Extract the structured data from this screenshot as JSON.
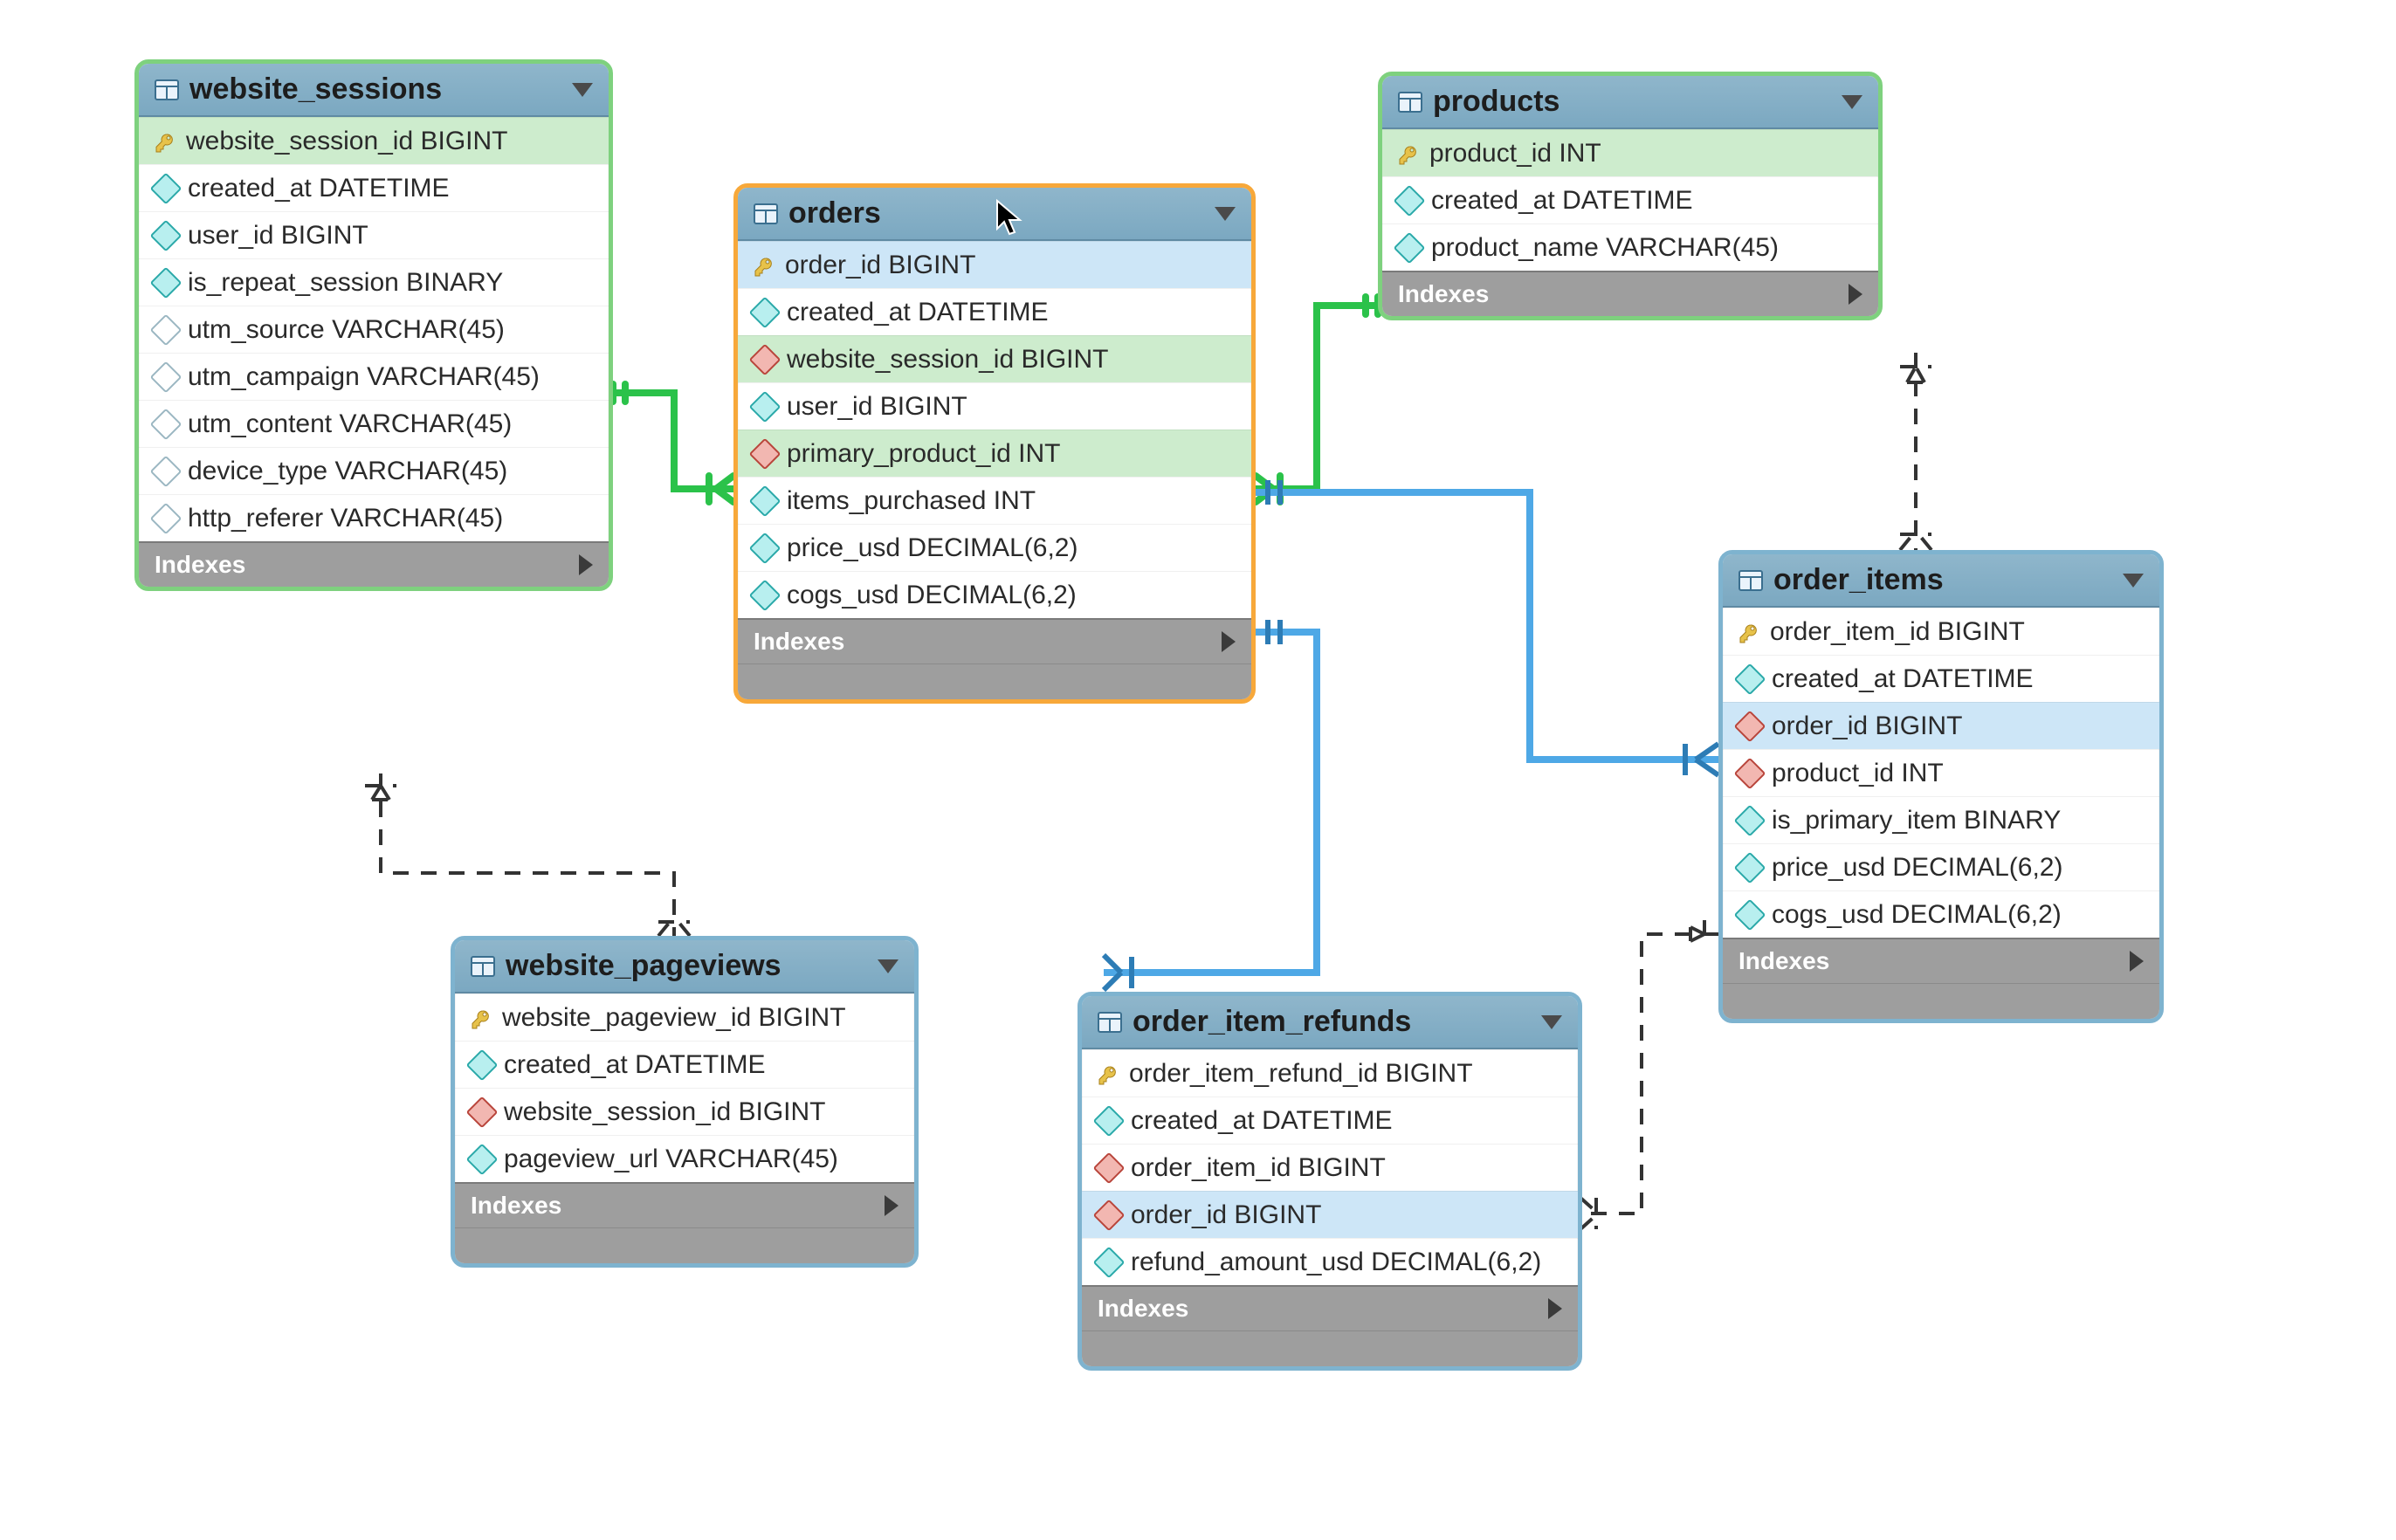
{
  "indexes_label": "Indexes",
  "tables": {
    "website_sessions": {
      "title": "website_sessions",
      "cols": [
        {
          "icon": "key",
          "text": "website_session_id BIGINT",
          "hl": "pk"
        },
        {
          "icon": "cyan",
          "text": "created_at DATETIME"
        },
        {
          "icon": "cyan",
          "text": "user_id BIGINT"
        },
        {
          "icon": "cyan",
          "text": "is_repeat_session BINARY"
        },
        {
          "icon": "hollow",
          "text": "utm_source VARCHAR(45)"
        },
        {
          "icon": "hollow",
          "text": "utm_campaign VARCHAR(45)"
        },
        {
          "icon": "hollow",
          "text": "utm_content VARCHAR(45)"
        },
        {
          "icon": "hollow",
          "text": "device_type VARCHAR(45)"
        },
        {
          "icon": "hollow",
          "text": "http_referer VARCHAR(45)"
        }
      ]
    },
    "orders": {
      "title": "orders",
      "cols": [
        {
          "icon": "key",
          "text": "order_id BIGINT",
          "hl": "pk2"
        },
        {
          "icon": "cyan",
          "text": "created_at DATETIME"
        },
        {
          "icon": "red",
          "text": "website_session_id BIGINT",
          "hl": "fk-green"
        },
        {
          "icon": "cyan",
          "text": "user_id BIGINT"
        },
        {
          "icon": "red",
          "text": "primary_product_id INT",
          "hl": "fk-green"
        },
        {
          "icon": "cyan",
          "text": "items_purchased INT"
        },
        {
          "icon": "cyan",
          "text": "price_usd DECIMAL(6,2)"
        },
        {
          "icon": "cyan",
          "text": "cogs_usd DECIMAL(6,2)"
        }
      ]
    },
    "products": {
      "title": "products",
      "cols": [
        {
          "icon": "key",
          "text": "product_id INT",
          "hl": "pk"
        },
        {
          "icon": "cyan",
          "text": "created_at DATETIME"
        },
        {
          "icon": "cyan",
          "text": "product_name VARCHAR(45)"
        }
      ]
    },
    "website_pageviews": {
      "title": "website_pageviews",
      "cols": [
        {
          "icon": "key",
          "text": "website_pageview_id BIGINT"
        },
        {
          "icon": "cyan",
          "text": "created_at DATETIME"
        },
        {
          "icon": "red",
          "text": "website_session_id BIGINT"
        },
        {
          "icon": "cyan",
          "text": "pageview_url VARCHAR(45)"
        }
      ]
    },
    "order_items": {
      "title": "order_items",
      "cols": [
        {
          "icon": "key",
          "text": "order_item_id BIGINT"
        },
        {
          "icon": "cyan",
          "text": "created_at DATETIME"
        },
        {
          "icon": "red",
          "text": "order_id BIGINT",
          "hl": "fk-blue"
        },
        {
          "icon": "red",
          "text": "product_id INT"
        },
        {
          "icon": "cyan",
          "text": "is_primary_item BINARY"
        },
        {
          "icon": "cyan",
          "text": "price_usd DECIMAL(6,2)"
        },
        {
          "icon": "cyan",
          "text": "cogs_usd DECIMAL(6,2)"
        }
      ]
    },
    "order_item_refunds": {
      "title": "order_item_refunds",
      "cols": [
        {
          "icon": "key",
          "text": "order_item_refund_id BIGINT"
        },
        {
          "icon": "cyan",
          "text": "created_at DATETIME"
        },
        {
          "icon": "red",
          "text": "order_item_id BIGINT"
        },
        {
          "icon": "red",
          "text": "order_id BIGINT",
          "hl": "fk-blue"
        },
        {
          "icon": "cyan",
          "text": "refund_amount_usd DECIMAL(6,2)"
        }
      ]
    }
  },
  "chart_data": {
    "type": "table",
    "title": "Entity-Relationship Diagram",
    "entities": [
      {
        "name": "website_sessions",
        "pk": [
          "website_session_id"
        ],
        "columns": [
          {
            "name": "website_session_id",
            "type": "BIGINT",
            "pk": true
          },
          {
            "name": "created_at",
            "type": "DATETIME"
          },
          {
            "name": "user_id",
            "type": "BIGINT"
          },
          {
            "name": "is_repeat_session",
            "type": "BINARY"
          },
          {
            "name": "utm_source",
            "type": "VARCHAR(45)",
            "nullable": true
          },
          {
            "name": "utm_campaign",
            "type": "VARCHAR(45)",
            "nullable": true
          },
          {
            "name": "utm_content",
            "type": "VARCHAR(45)",
            "nullable": true
          },
          {
            "name": "device_type",
            "type": "VARCHAR(45)",
            "nullable": true
          },
          {
            "name": "http_referer",
            "type": "VARCHAR(45)",
            "nullable": true
          }
        ]
      },
      {
        "name": "orders",
        "pk": [
          "order_id"
        ],
        "columns": [
          {
            "name": "order_id",
            "type": "BIGINT",
            "pk": true
          },
          {
            "name": "created_at",
            "type": "DATETIME"
          },
          {
            "name": "website_session_id",
            "type": "BIGINT",
            "fk": "website_sessions.website_session_id"
          },
          {
            "name": "user_id",
            "type": "BIGINT"
          },
          {
            "name": "primary_product_id",
            "type": "INT",
            "fk": "products.product_id"
          },
          {
            "name": "items_purchased",
            "type": "INT"
          },
          {
            "name": "price_usd",
            "type": "DECIMAL(6,2)"
          },
          {
            "name": "cogs_usd",
            "type": "DECIMAL(6,2)"
          }
        ]
      },
      {
        "name": "products",
        "pk": [
          "product_id"
        ],
        "columns": [
          {
            "name": "product_id",
            "type": "INT",
            "pk": true
          },
          {
            "name": "created_at",
            "type": "DATETIME"
          },
          {
            "name": "product_name",
            "type": "VARCHAR(45)"
          }
        ]
      },
      {
        "name": "website_pageviews",
        "pk": [
          "website_pageview_id"
        ],
        "columns": [
          {
            "name": "website_pageview_id",
            "type": "BIGINT",
            "pk": true
          },
          {
            "name": "created_at",
            "type": "DATETIME"
          },
          {
            "name": "website_session_id",
            "type": "BIGINT",
            "fk": "website_sessions.website_session_id"
          },
          {
            "name": "pageview_url",
            "type": "VARCHAR(45)"
          }
        ]
      },
      {
        "name": "order_items",
        "pk": [
          "order_item_id"
        ],
        "columns": [
          {
            "name": "order_item_id",
            "type": "BIGINT",
            "pk": true
          },
          {
            "name": "created_at",
            "type": "DATETIME"
          },
          {
            "name": "order_id",
            "type": "BIGINT",
            "fk": "orders.order_id"
          },
          {
            "name": "product_id",
            "type": "INT",
            "fk": "products.product_id"
          },
          {
            "name": "is_primary_item",
            "type": "BINARY"
          },
          {
            "name": "price_usd",
            "type": "DECIMAL(6,2)"
          },
          {
            "name": "cogs_usd",
            "type": "DECIMAL(6,2)"
          }
        ]
      },
      {
        "name": "order_item_refunds",
        "pk": [
          "order_item_refund_id"
        ],
        "columns": [
          {
            "name": "order_item_refund_id",
            "type": "BIGINT",
            "pk": true
          },
          {
            "name": "created_at",
            "type": "DATETIME"
          },
          {
            "name": "order_item_id",
            "type": "BIGINT",
            "fk": "order_items.order_item_id"
          },
          {
            "name": "order_id",
            "type": "BIGINT",
            "fk": "orders.order_id"
          },
          {
            "name": "refund_amount_usd",
            "type": "DECIMAL(6,2)"
          }
        ]
      }
    ],
    "relationships": [
      {
        "from": "orders.website_session_id",
        "to": "website_sessions.website_session_id",
        "type": "many-to-one",
        "identifying": true
      },
      {
        "from": "orders.primary_product_id",
        "to": "products.product_id",
        "type": "many-to-one",
        "identifying": true
      },
      {
        "from": "website_pageviews.website_session_id",
        "to": "website_sessions.website_session_id",
        "type": "many-to-one",
        "identifying": false
      },
      {
        "from": "order_items.order_id",
        "to": "orders.order_id",
        "type": "many-to-one",
        "identifying": true
      },
      {
        "from": "order_items.product_id",
        "to": "products.product_id",
        "type": "many-to-one",
        "identifying": false
      },
      {
        "from": "order_item_refunds.order_id",
        "to": "orders.order_id",
        "type": "many-to-one",
        "identifying": true
      },
      {
        "from": "order_item_refunds.order_item_id",
        "to": "order_items.order_item_id",
        "type": "many-to-one",
        "identifying": false
      }
    ]
  }
}
